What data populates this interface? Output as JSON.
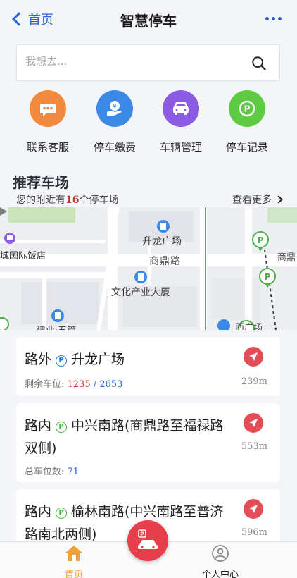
{
  "header": {
    "back_label": "首页",
    "title": "智慧停车"
  },
  "search": {
    "placeholder": "我想去..."
  },
  "actions": [
    {
      "label": "联系客服",
      "color": "#f18a3f",
      "icon": "chat-icon"
    },
    {
      "label": "停车缴费",
      "color": "#3c88e6",
      "icon": "payment-icon"
    },
    {
      "label": "车辆管理",
      "color": "#8b5ce3",
      "icon": "car-icon"
    },
    {
      "label": "停车记录",
      "color": "#5fcb45",
      "icon": "parking-record-icon"
    }
  ],
  "section": {
    "title": "推荐车场",
    "subtitle_prefix": "您的附近有",
    "count": "16",
    "subtitle_suffix": "个停车场",
    "see_more": "查看更多"
  },
  "map": {
    "labels": {
      "hotel": "城国际饭店",
      "plaza": "升龙广场",
      "road": "商鼎路",
      "building": "文化产业大厦",
      "road_right": "商鼎",
      "bottom_left": "建业·五篇",
      "bottom_right": "西广场"
    }
  },
  "lots": [
    {
      "type": "路外",
      "tag": "P",
      "tag_color": "blue",
      "name": "升龙广场",
      "meta_label": "剩余车位: ",
      "free": "1235",
      "sep": " / ",
      "total": "2653",
      "distance": "239m"
    },
    {
      "type": "路内",
      "tag": "P",
      "tag_color": "green",
      "name": "中兴南路(商鼎路至福禄路双侧)",
      "meta_label": "总车位数: ",
      "total": "71",
      "distance": "553m"
    },
    {
      "type": "路内",
      "tag": "P",
      "tag_color": "green",
      "name": "榆林南路(中兴南路至普济路南北两侧)",
      "distance": "596m"
    }
  ],
  "tabbar": {
    "home": "首页",
    "profile": "个人中心"
  },
  "colors": {
    "accent": "#2a66d8",
    "nav": "#e34d58",
    "home_tab": "#f0a13a"
  }
}
